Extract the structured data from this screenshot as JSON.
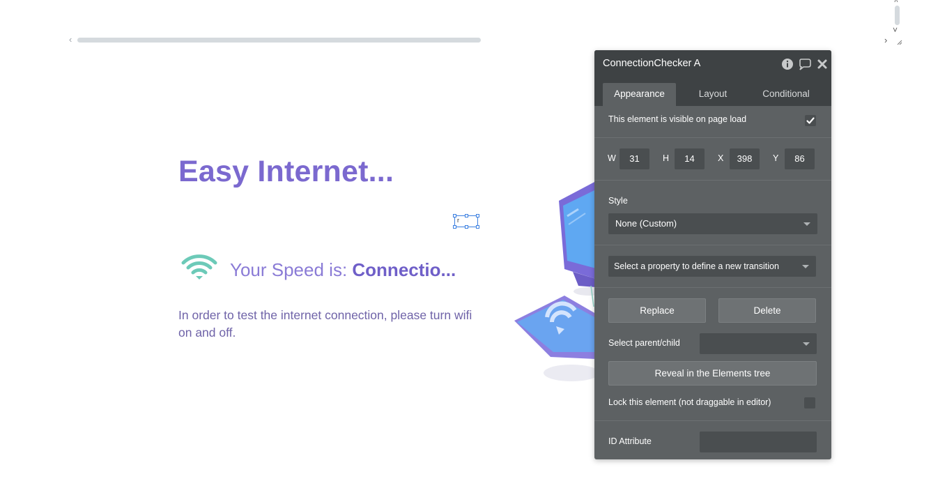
{
  "page": {
    "headline": "Easy Internet...",
    "speed_prefix": "Your Speed is: ",
    "speed_value": "Connectio...",
    "instructions": "In order to test the internet connection, please turn wifi on and off.",
    "selected_element_text": "r"
  },
  "panel": {
    "title": "ConnectionChecker A",
    "tabs": [
      "Appearance",
      "Layout",
      "Conditional"
    ],
    "active_tab": "Appearance",
    "visible_on_load_label": "This element is visible on page load",
    "visible_on_load": true,
    "dimensions": {
      "w_label": "W",
      "w": "31",
      "h_label": "H",
      "h": "14",
      "x_label": "X",
      "x": "398",
      "y_label": "Y",
      "y": "86"
    },
    "style_label": "Style",
    "style_value": "None (Custom)",
    "transition_placeholder": "Select a property to define a new transition",
    "replace_label": "Replace",
    "delete_label": "Delete",
    "parent_child_label": "Select parent/child",
    "parent_child_value": "",
    "reveal_label": "Reveal in the Elements tree",
    "lock_label": "Lock this element (not draggable in editor)",
    "lock_checked": false,
    "id_attribute_label": "ID Attribute",
    "id_attribute_value": ""
  },
  "icons": {
    "wifi": "wifi-icon",
    "info": "info-icon",
    "comment": "comment-icon",
    "close": "close-icon",
    "check": "check-icon"
  },
  "colors": {
    "brand_purple": "#7b69cf",
    "wifi_teal": "#6ccab8",
    "panel_bg": "#5d6163",
    "panel_header": "#3e4244"
  }
}
